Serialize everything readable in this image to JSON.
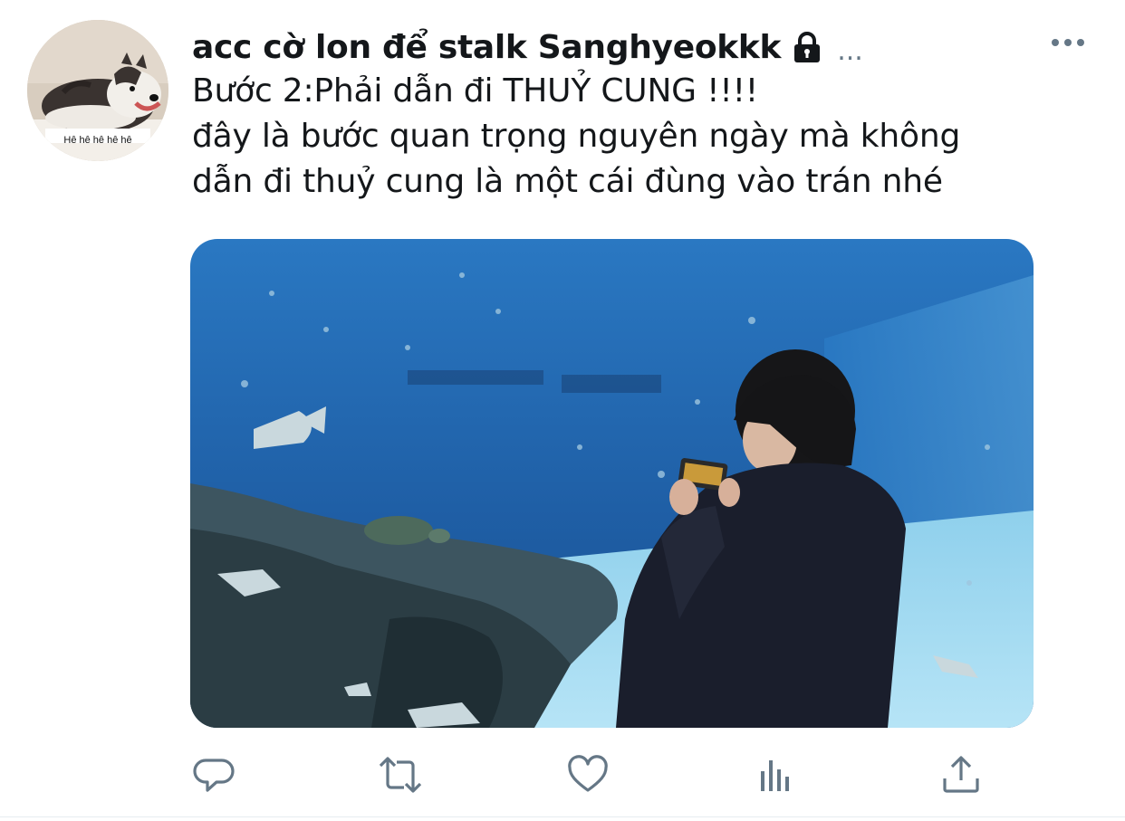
{
  "tweet": {
    "author": {
      "display_name": "acc cờ lon để stalk Sanghyeokkk",
      "avatar_caption": "Hê hê hê hê hê",
      "handle_truncated": "..."
    },
    "text_lines": [
      "Bước 2:Phải dẫn đi THUỶ CUNG !!!!",
      "đây là bước quan trọng nguyên ngày mà không",
      "dẫn đi thuỷ cung là một cái đùng vào trán nhé"
    ],
    "media": {
      "description_icon": "aquarium-photo"
    },
    "actions": [
      {
        "name": "reply",
        "icon": "speech-bubble-icon"
      },
      {
        "name": "retweet",
        "icon": "retweet-arrows-icon"
      },
      {
        "name": "like",
        "icon": "heart-icon"
      },
      {
        "name": "analytics",
        "icon": "bar-chart-icon"
      },
      {
        "name": "share",
        "icon": "share-upload-icon"
      }
    ]
  },
  "colors": {
    "text_primary": "#14171a",
    "icon_gray": "#657786",
    "divider": "#e6ecf0",
    "water_blue": "#2f7fc0"
  }
}
